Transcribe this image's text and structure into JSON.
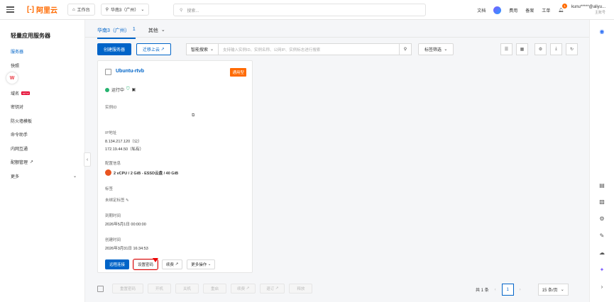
{
  "topbar": {
    "logo_text": "阿里云",
    "workbench": "工作台",
    "region": "华南3（广州）",
    "search_placeholder": "搜索...",
    "links": [
      "文档",
      "费用",
      "备案",
      "工单"
    ],
    "notification_count": "1",
    "user_name": "kunu*****@aliyu...",
    "user_sub": "主账号"
  },
  "sidebar": {
    "title": "轻量应用服务器",
    "items": [
      {
        "label": "服务器",
        "active": true
      },
      {
        "label": "快照"
      },
      {
        "label": "镜像"
      },
      {
        "label": "域名",
        "tag": "NEW"
      },
      {
        "label": "密钥对"
      },
      {
        "label": "防火墙模板"
      },
      {
        "label": "命令助手"
      },
      {
        "label": "内网互通"
      },
      {
        "label": "配额管理"
      },
      {
        "label": "更多"
      }
    ]
  },
  "tabs": [
    {
      "label": "华南3（广州）",
      "count": "1",
      "active": true
    },
    {
      "label": "其他"
    }
  ],
  "toolbar": {
    "create": "创建服务器",
    "migrate": "迁移上云",
    "smart_search": "智能搜索",
    "filter_placeholder": "支持输入实例ID、实例名称、公网IP、实例标志进行搜索",
    "tag_filter": "标签筛选"
  },
  "instance": {
    "name": "Ubuntu-rtvb",
    "type_badge": "通用型",
    "status": "运行中",
    "id_label": "实例ID",
    "ip_label": "IP地址",
    "public_ip": "8.134.217.120（公）",
    "private_ip": "172.19.44.50（私有）",
    "config_label": "配置信息",
    "config": "2 vCPU / 2 GiB - ESSD云盘 / 40 GiB",
    "tag_label": "标签",
    "tag_value": "未绑定标签",
    "expire_label": "到期时间",
    "expire_value": "2026年5月1日 00:00:00",
    "created_label": "创建时间",
    "created_value": "2026年3月31日 16:34:53",
    "actions": [
      "远程连接",
      "设置密码",
      "续费",
      "更多操作"
    ]
  },
  "bulk_actions": [
    "重置密码",
    "开机",
    "关机",
    "重启",
    "续费",
    "退订",
    "释放"
  ],
  "pagination": {
    "total": "共 1 条",
    "page": "1",
    "page_size": "15 条/页"
  }
}
